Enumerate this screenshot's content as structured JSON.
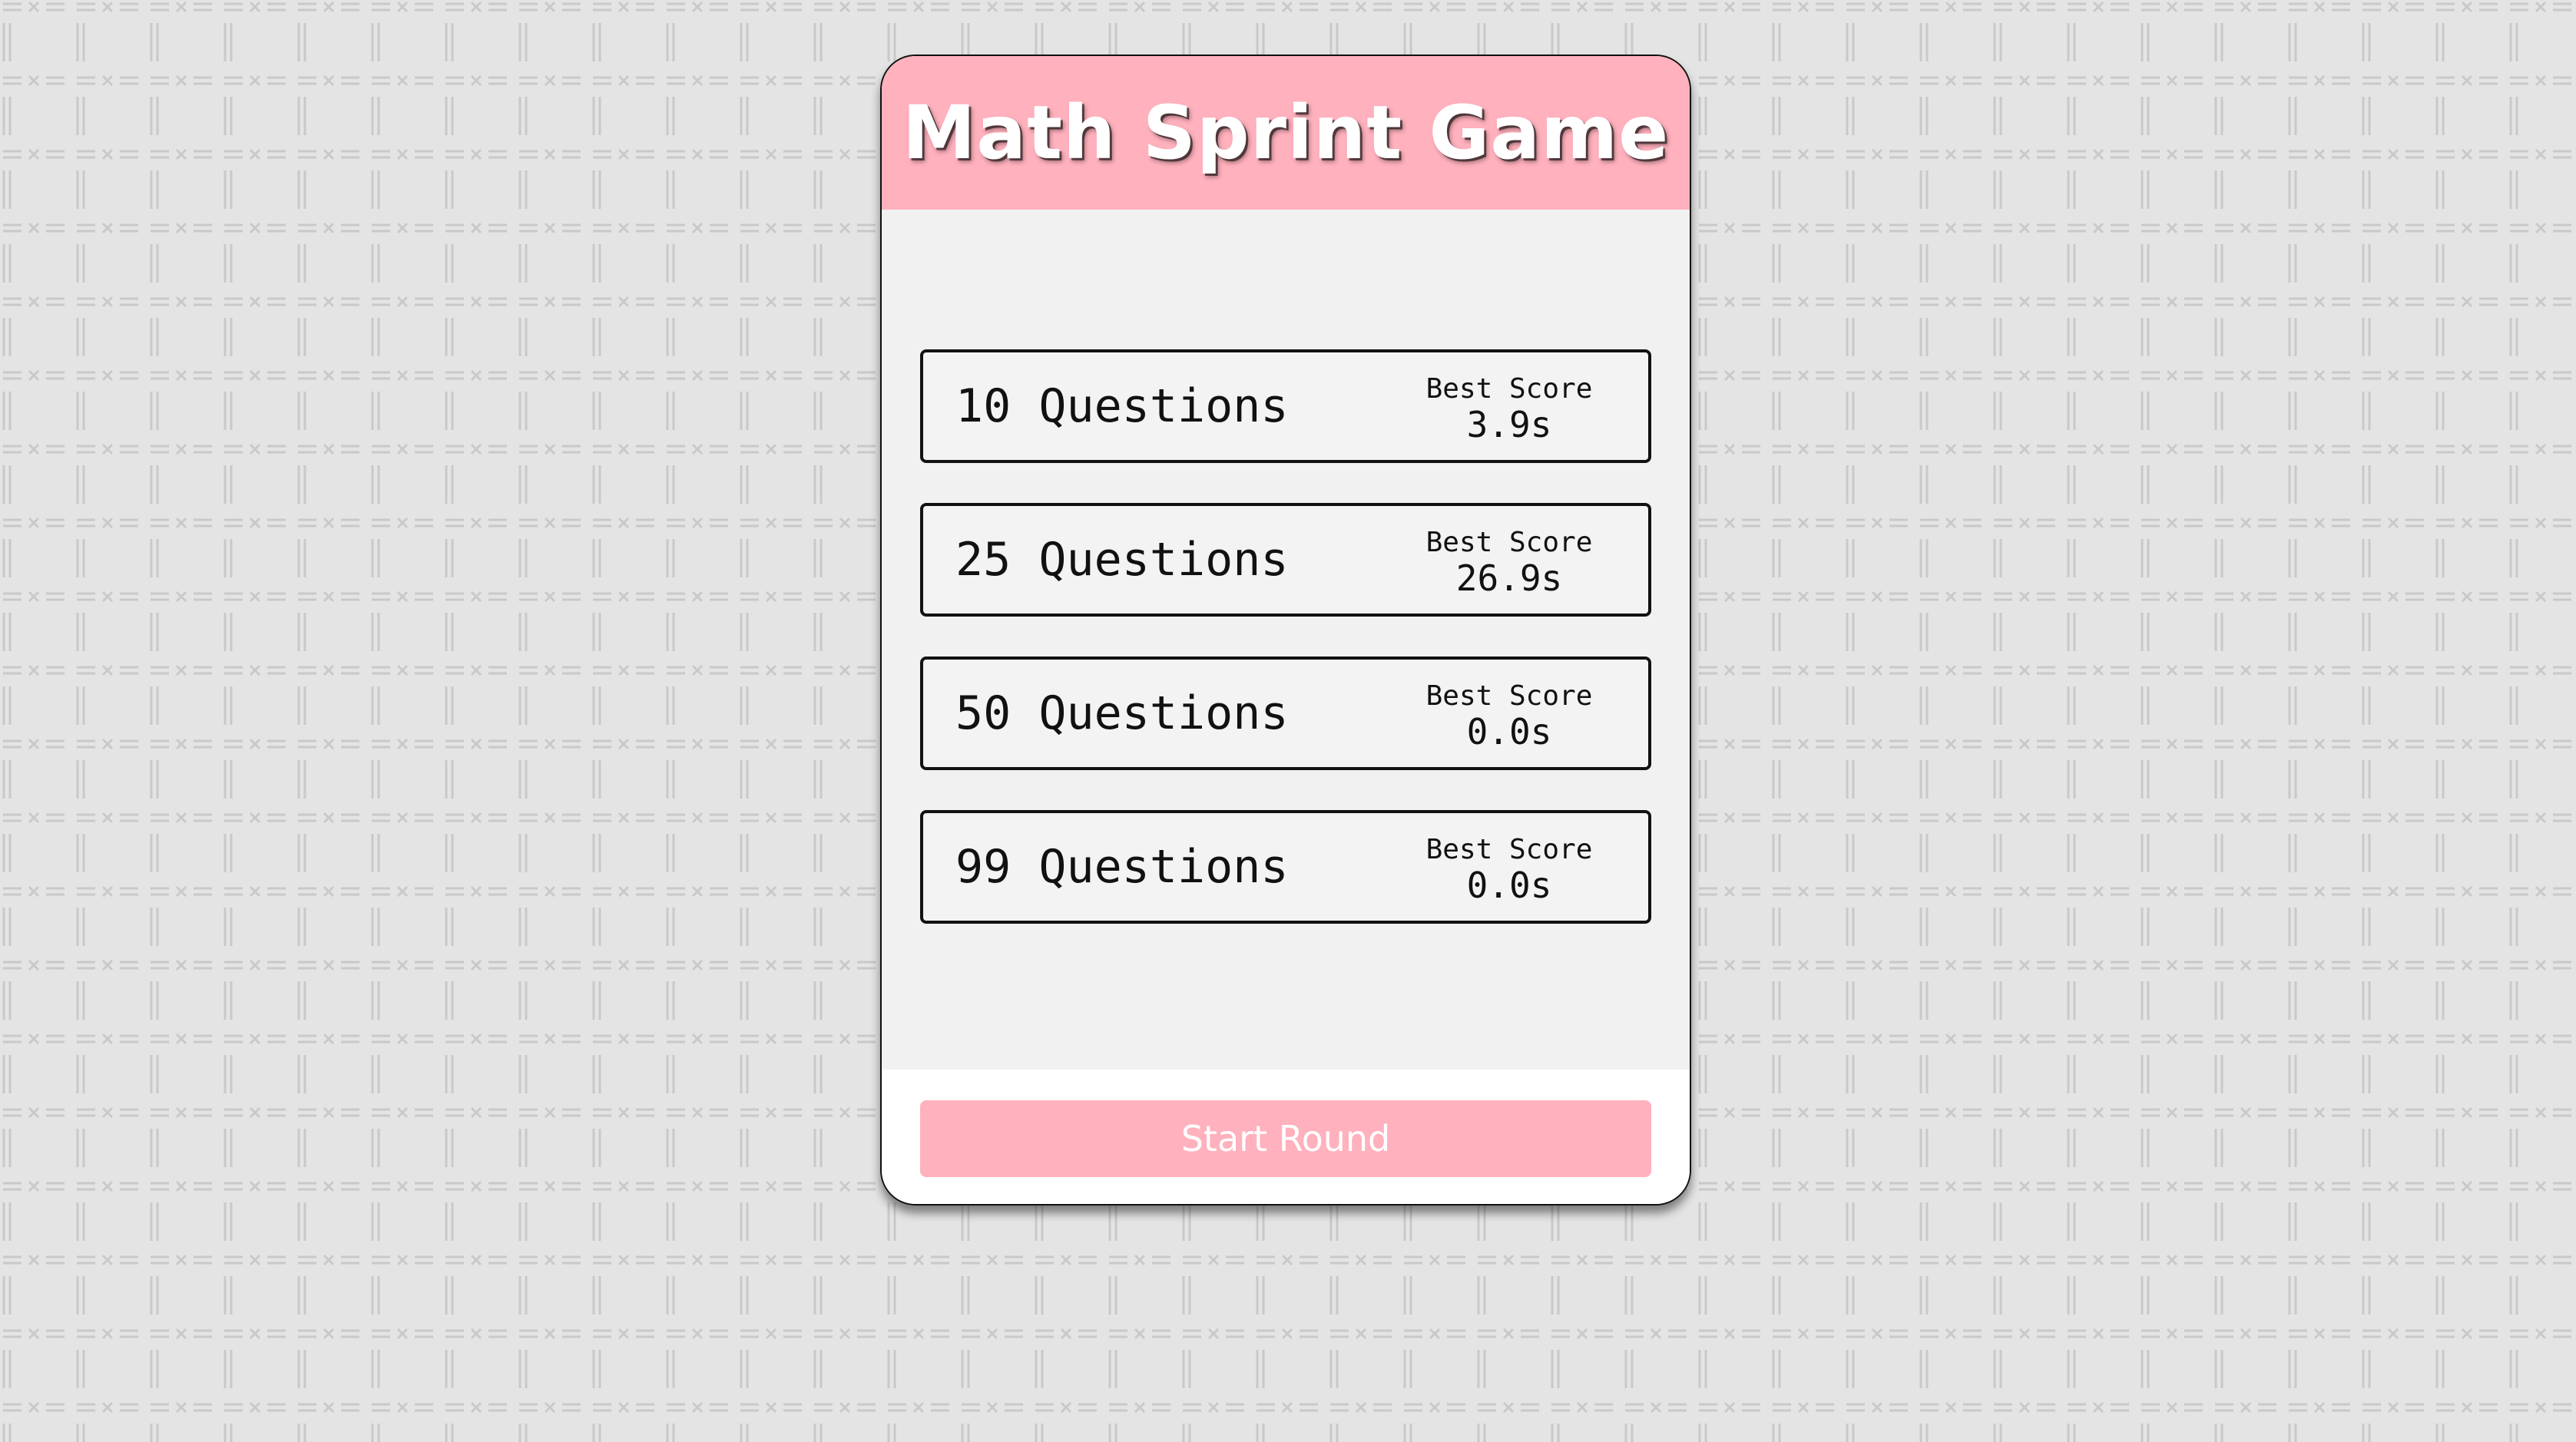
{
  "page": {
    "title": "Math Sprint Game"
  },
  "selection": {
    "items": [
      {
        "label": "10 Questions",
        "best_score_label": "Best Score",
        "best_score": "3.9s"
      },
      {
        "label": "25 Questions",
        "best_score_label": "Best Score",
        "best_score": "26.9s"
      },
      {
        "label": "50 Questions",
        "best_score_label": "Best Score",
        "best_score": "0.0s"
      },
      {
        "label": "99 Questions",
        "best_score_label": "Best Score",
        "best_score": "0.0s"
      }
    ]
  },
  "footer": {
    "start_label": "Start Round"
  },
  "colors": {
    "accent": "#ffb1bd",
    "background": "#e4e4e4",
    "text": "#111111"
  }
}
